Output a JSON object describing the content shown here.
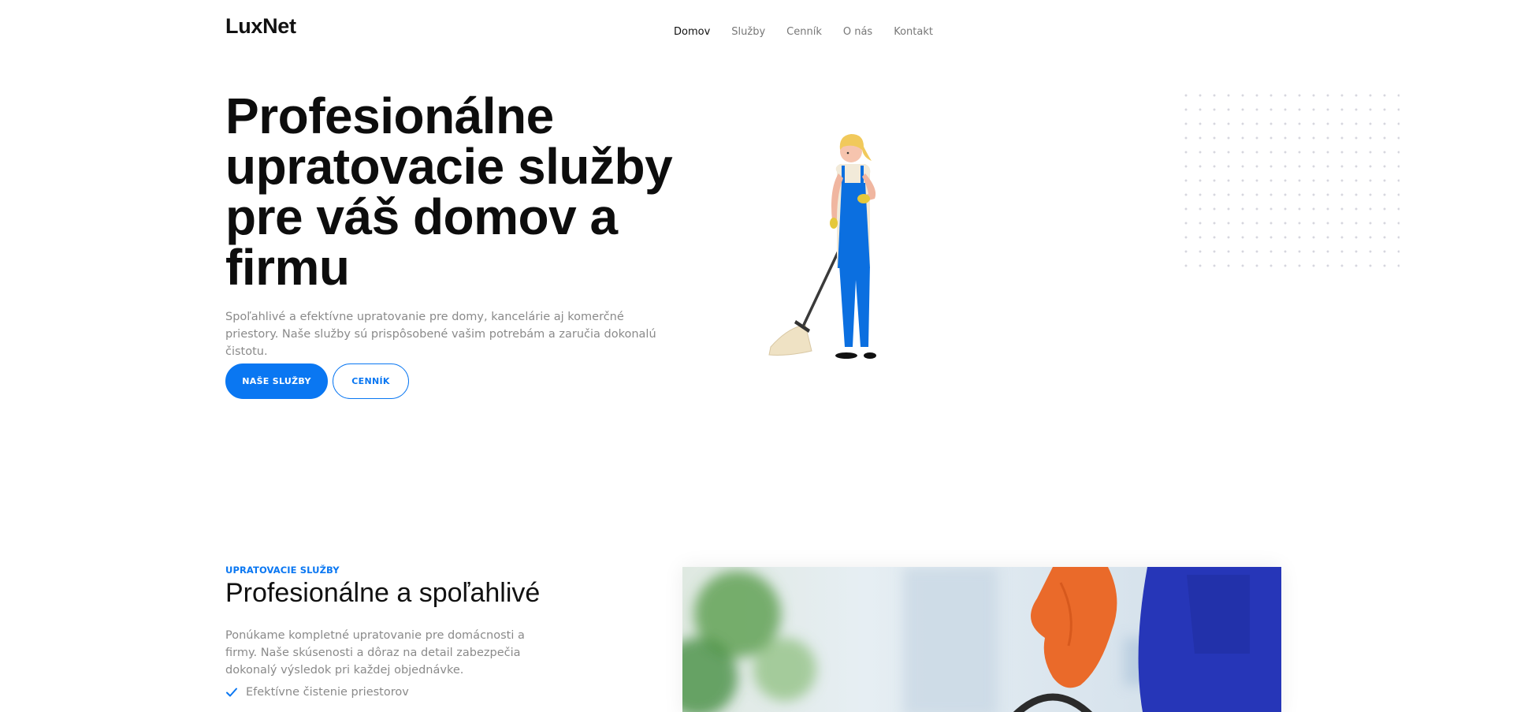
{
  "brand": {
    "name": "LuxNet",
    "accent": "#0a77f2"
  },
  "nav": {
    "items": [
      {
        "label": "Domov",
        "active": true
      },
      {
        "label": "Služby",
        "active": false
      },
      {
        "label": "Cenník",
        "active": false
      },
      {
        "label": "O nás",
        "active": false
      },
      {
        "label": "Kontakt",
        "active": false
      }
    ]
  },
  "hero": {
    "title": "Profesionálne upratovacie služby pre váš domov a firmu",
    "subtitle": "Spoľahlivé a efektívne upratovanie pre domy, kancelárie aj komerčné priestory. Naše služby sú prispôsobené vašim potrebám a zaručia dokonalú čistotu.",
    "primary_button": "NAŠE SLUŽBY",
    "secondary_button": "CENNÍK",
    "illustration_icon": "cleaning-woman-illustration"
  },
  "services": {
    "eyebrow": "UPRATOVACIE SLUŽBY",
    "title": "Profesionálne a spoľahlivé",
    "text": "Ponúkame kompletné upratovanie pre domácnosti a firmy. Naše skúsenosti a dôraz na detail zabezpečia dokonalý výsledok pri každej objednávke.",
    "features": [
      "Efektívne čistenie priestorov"
    ],
    "photo_icon": "cleaner-photo"
  }
}
